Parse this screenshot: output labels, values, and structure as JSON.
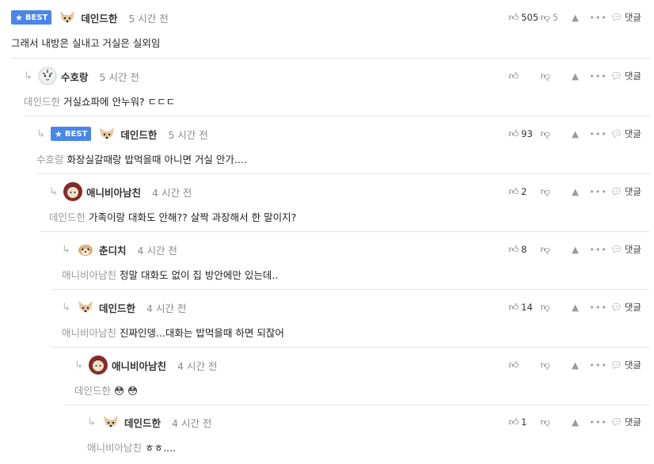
{
  "common": {
    "best_label": "BEST",
    "reply_label": "댓글",
    "more_label": "•••",
    "star_glyph": "★",
    "arrow_glyph": "↳"
  },
  "comments": [
    {
      "author": "데인드한",
      "time": "5 시간 전",
      "best": true,
      "avatar": "dog-avatar",
      "mention": "",
      "text": "그래서 내방은 실내고 거실은 실외임",
      "likes": "505",
      "dislikes": "5"
    },
    {
      "author": "수호랑",
      "time": "5 시간 전",
      "best": false,
      "avatar": "tiger-avatar",
      "mention": "데인드한",
      "text": "거실쇼파에 안누워? ㄷㄷㄷ",
      "likes": "",
      "dislikes": ""
    },
    {
      "author": "데인드한",
      "time": "5 시간 전",
      "best": true,
      "avatar": "dog-avatar",
      "mention": "수호랑",
      "text": "화장실갈때랑 밥먹을때 아니면 거실 안가....",
      "likes": "93",
      "dislikes": ""
    },
    {
      "author": "애니비아남친",
      "time": "4 시간 전",
      "best": false,
      "avatar": "character-avatar",
      "mention": "데인드한",
      "text": "가족이랑 대화도 안해?? 살짝 과장해서 한 말이지?",
      "likes": "2",
      "dislikes": ""
    },
    {
      "author": "춘디치",
      "time": "4 시간 전",
      "best": false,
      "avatar": "puppy-avatar",
      "mention": "애니비아남친",
      "text": "정말 대화도 없이 집 방안에만 있는데..",
      "likes": "8",
      "dislikes": ""
    },
    {
      "author": "데인드한",
      "time": "4 시간 전",
      "best": false,
      "avatar": "dog-avatar",
      "mention": "애니비아남친",
      "text": "진짜인뎅...대화는 밥먹을때 하면 되잖어",
      "likes": "14",
      "dislikes": ""
    },
    {
      "author": "애니비아남친",
      "time": "4 시간 전",
      "best": false,
      "avatar": "character-avatar",
      "mention": "데인드한",
      "text": "😳 😳",
      "likes": "",
      "dislikes": ""
    },
    {
      "author": "데인드한",
      "time": "4 시간 전",
      "best": false,
      "avatar": "dog-avatar",
      "mention": "애니비아남친",
      "text": "ㅎㅎ....",
      "likes": "1",
      "dislikes": ""
    }
  ]
}
